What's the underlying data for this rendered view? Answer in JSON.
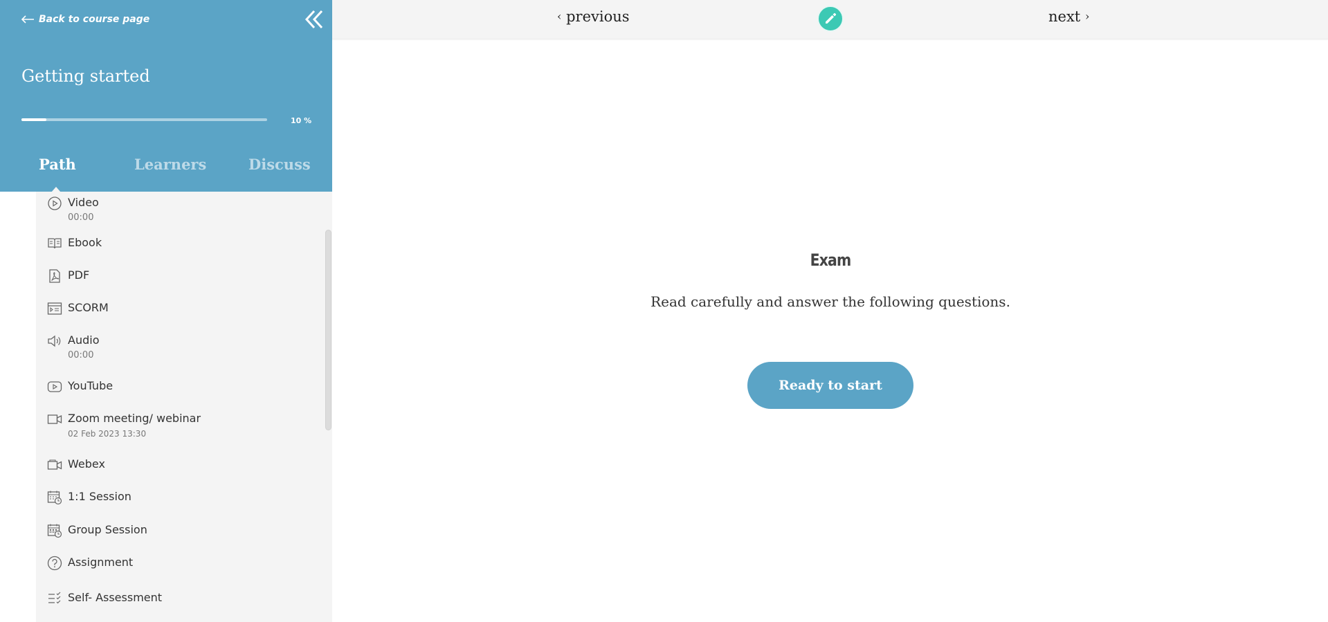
{
  "sidebar": {
    "back_label": "Back to course page",
    "course_title": "Getting started",
    "progress": {
      "value_percent": 10,
      "label": "10 %"
    },
    "tabs": [
      {
        "label": "Path",
        "active": true
      },
      {
        "label": "Learners",
        "active": false
      },
      {
        "label": "Discuss",
        "active": false
      }
    ],
    "items": [
      {
        "title": "Video",
        "subtitle": "00:00",
        "icon": "play-circle-icon"
      },
      {
        "title": "Ebook",
        "icon": "book-icon"
      },
      {
        "title": "PDF",
        "icon": "pdf-icon"
      },
      {
        "title": "SCORM",
        "icon": "scorm-icon"
      },
      {
        "title": "Audio",
        "subtitle": "00:00",
        "icon": "speaker-icon"
      },
      {
        "title": "YouTube",
        "icon": "youtube-icon"
      },
      {
        "title": "Zoom meeting/ webinar",
        "subtitle": "02 Feb 2023 13:30",
        "icon": "video-camera-icon"
      },
      {
        "title": "Webex",
        "icon": "video-camera-icon"
      },
      {
        "title": "1:1 Session",
        "icon": "calendar-clock-icon"
      },
      {
        "title": "Group Session",
        "icon": "group-calendar-icon"
      },
      {
        "title": "Assignment",
        "icon": "question-circle-icon"
      },
      {
        "title": "Self- Assessment",
        "icon": "checklist-icon"
      }
    ]
  },
  "topbar": {
    "previous_label": "previous",
    "next_label": "next",
    "edit_icon": "pencil-icon"
  },
  "main": {
    "title": "Exam",
    "description": "Read carefully and answer the following questions.",
    "start_label": "Ready to start"
  },
  "colors": {
    "accent": "#5ba4c6",
    "edit_button": "#3cc9b4",
    "panel_bg": "#f4f4f4"
  }
}
